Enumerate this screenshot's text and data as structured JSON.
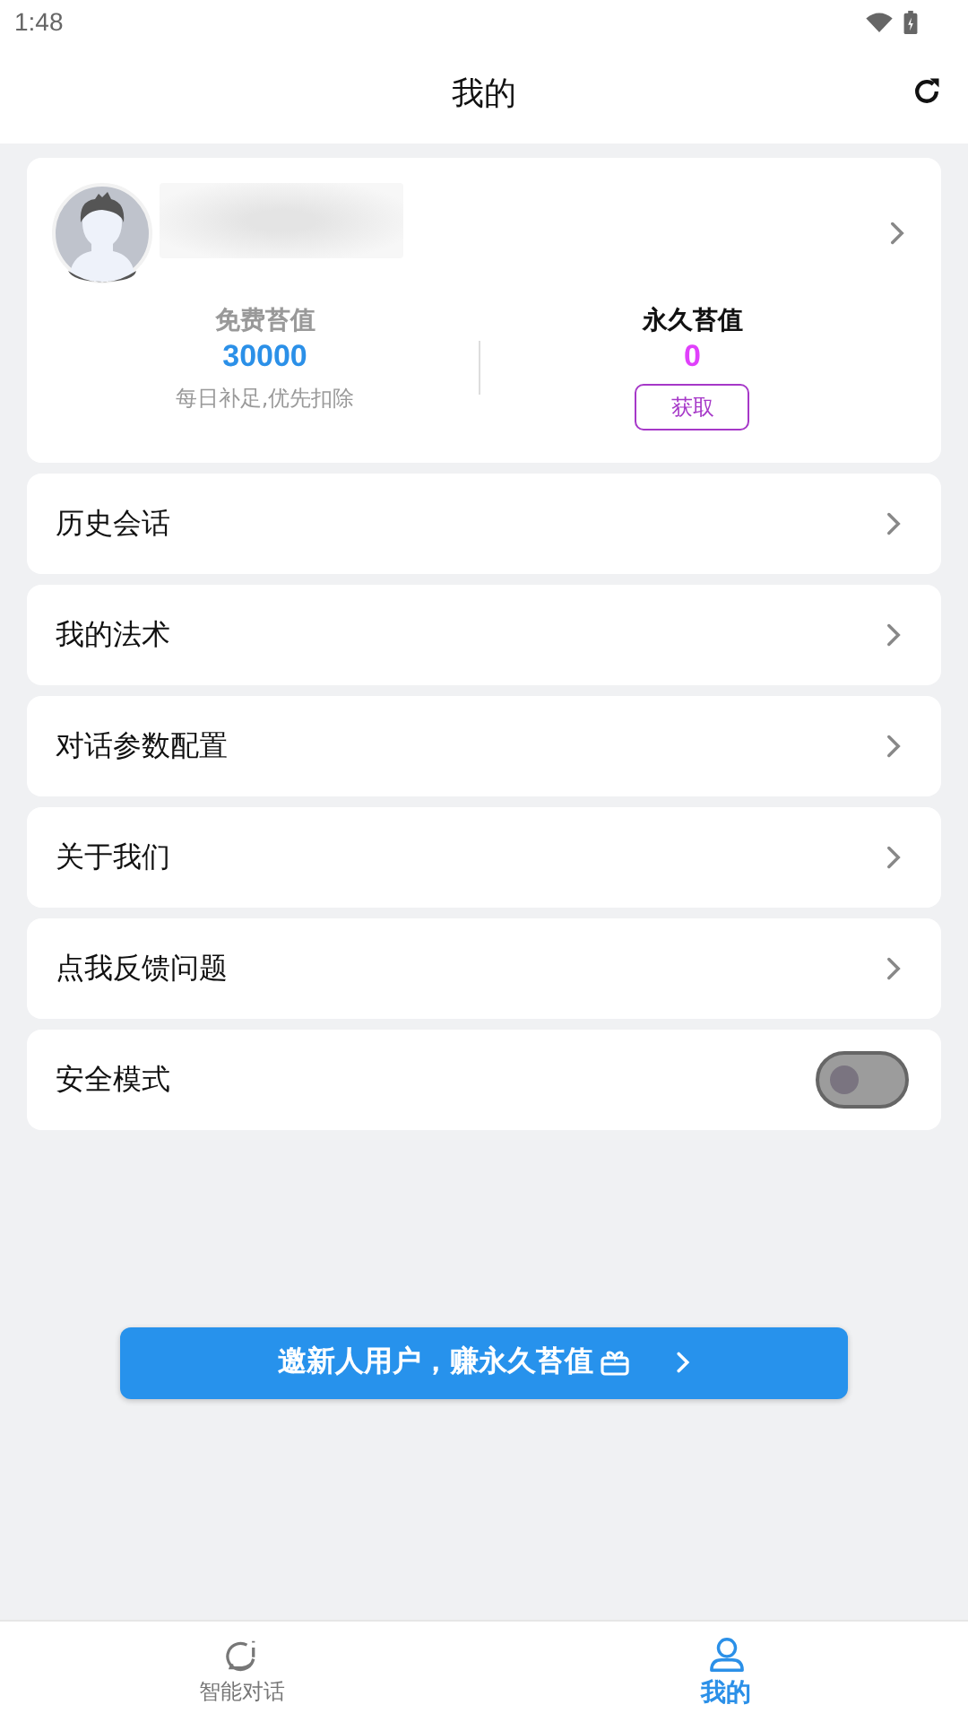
{
  "status_bar": {
    "time": "1:48"
  },
  "header": {
    "title": "我的"
  },
  "profile": {
    "free_credit": {
      "label": "免费苔值",
      "value": "30000",
      "note": "每日补足,优先扣除"
    },
    "permanent_credit": {
      "label": "永久苔值",
      "value": "0",
      "button": "获取"
    }
  },
  "menu": [
    {
      "kind": "link",
      "label": "历史会话"
    },
    {
      "kind": "link",
      "label": "我的法术"
    },
    {
      "kind": "link",
      "label": "对话参数配置"
    },
    {
      "kind": "link",
      "label": "关于我们"
    },
    {
      "kind": "link",
      "label": "点我反馈问题"
    },
    {
      "kind": "toggle",
      "label": "安全模式",
      "on": false
    }
  ],
  "invite_button": {
    "label": "邀新人用户，赚永久苔值"
  },
  "bottom_nav": [
    {
      "label": "智能对话",
      "selected": false
    },
    {
      "label": "我的",
      "selected": true
    }
  ]
}
